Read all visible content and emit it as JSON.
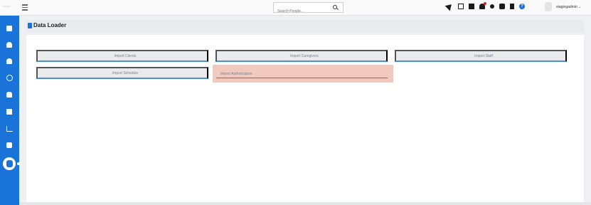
{
  "header": {
    "logo_text": "=====",
    "search_placeholder": "Search People...",
    "username": "stagingadmin ⌄"
  },
  "toolbar_icons": [
    "send-icon",
    "calendar-icon",
    "book-icon",
    "bell-icon",
    "gear-icon",
    "chat-icon",
    "clipboard-icon",
    "help-icon"
  ],
  "sidebar": {
    "items": [
      "dashboard-icon",
      "user-icon",
      "user-icon",
      "clock-icon",
      "flask-icon",
      "presentation-icon",
      "chart-icon",
      "monitor-icon",
      "database-icon"
    ],
    "accent_color": "#1a73d9"
  },
  "page": {
    "title": "Data Loader"
  },
  "import_buttons": [
    {
      "label": "Import Clients"
    },
    {
      "label": "Import Caregivers"
    },
    {
      "label": "Import Staff"
    },
    {
      "label": "Import Schedule"
    },
    {
      "label": "Import Authorization"
    }
  ],
  "colors": {
    "highlight": "#f2c9be",
    "button_underline": "#4a90d9"
  }
}
